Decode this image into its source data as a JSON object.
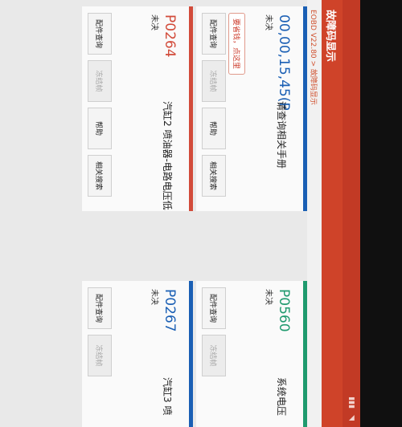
{
  "statusbar": {
    "time": "",
    "icons": ""
  },
  "appbar": {
    "title": "故障码显示"
  },
  "breadcrumb": {
    "path": "EOBD V22.80 > 故障码显示"
  },
  "side": {
    "label": "EOBD"
  },
  "tooltip": {
    "text": "要省钱，点这里"
  },
  "cards": [
    {
      "code": "00,00,15,45(P",
      "status": "未决",
      "desc": "请查询相关手册",
      "color": "#1a5fb4",
      "buttons": [
        "配件查询",
        "冻结帧",
        "帮助",
        "相关搜索"
      ]
    },
    {
      "code": "P0264",
      "status": "未决",
      "desc": "汽缸2 喷油器-电路电压低",
      "color": "#d24b3a",
      "buttons": [
        "配件查询",
        "冻结帧",
        "帮助",
        "相关搜索"
      ]
    },
    {
      "code": "P0560",
      "status": "未决",
      "desc": "系统电压",
      "color": "#1f9a6e",
      "buttons": [
        "配件查询",
        "冻结帧"
      ]
    },
    {
      "code": "P0267",
      "status": "未决",
      "desc": "汽缸3 喷",
      "color": "#1a5fb4",
      "buttons": [
        "配件查询",
        "冻结帧"
      ]
    }
  ],
  "nav": {
    "back": "◁",
    "home": "○",
    "recent": "□"
  }
}
